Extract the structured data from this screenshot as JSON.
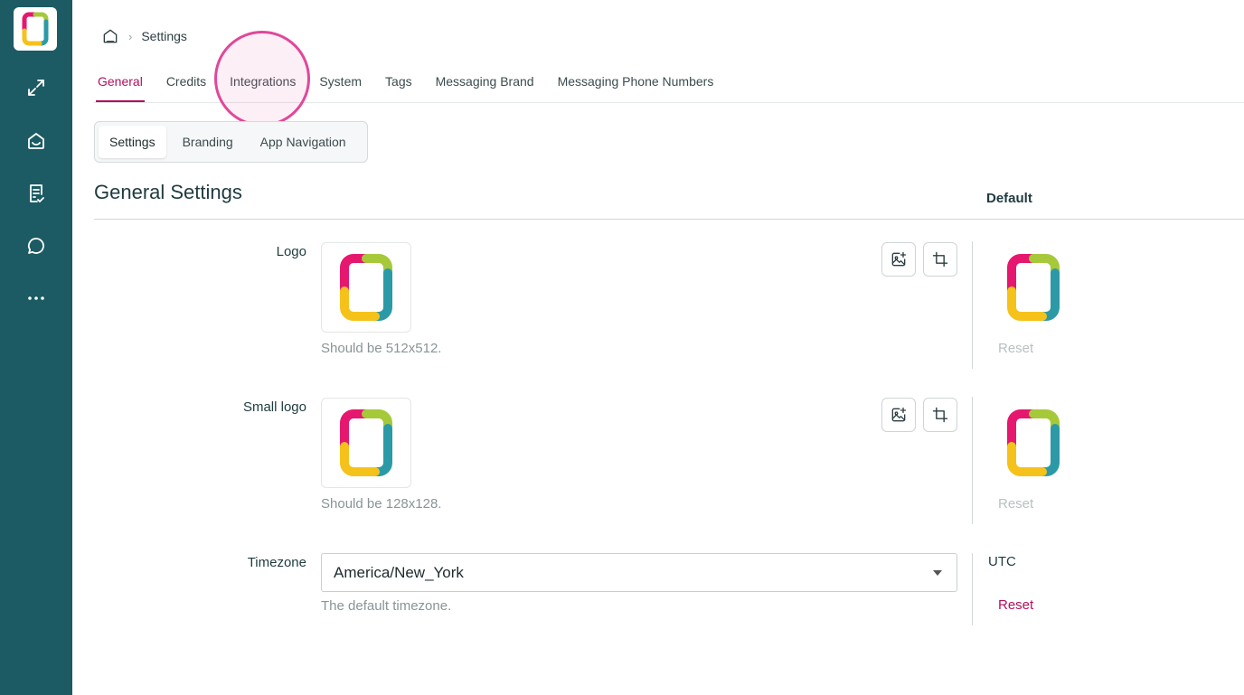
{
  "sidebar": {
    "items": [
      {
        "name": "expand-icon"
      },
      {
        "name": "inbox-icon"
      },
      {
        "name": "tasks-icon"
      },
      {
        "name": "chat-icon"
      },
      {
        "name": "more-icon"
      }
    ]
  },
  "breadcrumb": {
    "current": "Settings"
  },
  "tabs": [
    {
      "label": "General",
      "active": true
    },
    {
      "label": "Credits",
      "active": false
    },
    {
      "label": "Integrations",
      "active": false
    },
    {
      "label": "System",
      "active": false
    },
    {
      "label": "Tags",
      "active": false
    },
    {
      "label": "Messaging Brand",
      "active": false
    },
    {
      "label": "Messaging Phone Numbers",
      "active": false
    }
  ],
  "subtabs": [
    {
      "label": "Settings",
      "active": true
    },
    {
      "label": "Branding",
      "active": false
    },
    {
      "label": "App Navigation",
      "active": false
    }
  ],
  "section": {
    "title": "General Settings",
    "default_header": "Default"
  },
  "rows": {
    "logo": {
      "label": "Logo",
      "hint": "Should be 512x512.",
      "reset": "Reset"
    },
    "small_logo": {
      "label": "Small logo",
      "hint": "Should be 128x128.",
      "reset": "Reset"
    },
    "timezone": {
      "label": "Timezone",
      "value": "America/New_York",
      "hint": "The default timezone.",
      "default_value": "UTC",
      "reset": "Reset"
    }
  },
  "colors": {
    "sidebar": "#1c5b63",
    "accent": "#b0105c",
    "logo_pink": "#e6176e",
    "logo_green": "#a6c93a",
    "logo_teal": "#2c9aa6",
    "logo_yellow": "#f5c21b"
  }
}
